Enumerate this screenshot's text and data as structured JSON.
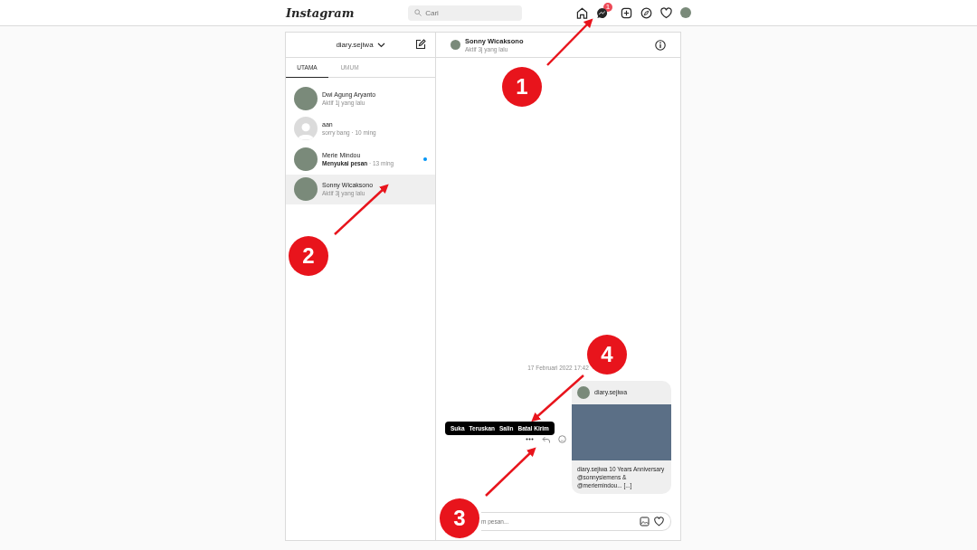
{
  "nav": {
    "logo": "Instagram",
    "search": {
      "placeholder": "Cari"
    },
    "notification_badge": "1"
  },
  "inbox": {
    "account": "diary.sejiwa",
    "tabs": [
      {
        "label": "UTAMA",
        "selected": true
      },
      {
        "label": "UMUM",
        "selected": false
      }
    ],
    "threads": [
      {
        "name": "Dwi Agung Aryanto",
        "preview": "Aktif 1j yang lalu",
        "selected": false,
        "unread": false,
        "kind": "photo"
      },
      {
        "name": "aan",
        "preview": "sorry bang · 10 ming",
        "selected": false,
        "unread": false,
        "kind": "blank"
      },
      {
        "name": "Merie Mindou",
        "preview": "**Menyukai pesan** · 13 ming",
        "selected": false,
        "unread": true,
        "kind": "photo"
      },
      {
        "name": "Sonny Wicaksono",
        "preview": "Aktif 3j yang lalu",
        "selected": true,
        "unread": false,
        "kind": "photo"
      }
    ]
  },
  "chat": {
    "name": "Sonny Wicaksono",
    "status": "Aktif 3j yang lalu",
    "timestamp": "17 Februari 2022 17:42",
    "post": {
      "author": "diary.sejiwa",
      "caption": "**diary.sejiwa** 10 Years Anniversary @sonnysiemens & @meriemindou... [...]"
    },
    "menu": [
      "Suka",
      "Teruskan",
      "Salin",
      "Batal Kirim"
    ],
    "input": {
      "placeholder": "m pesan..."
    }
  },
  "annotations": [
    {
      "label": "1"
    },
    {
      "label": "2"
    },
    {
      "label": "3"
    },
    {
      "label": "4"
    }
  ]
}
